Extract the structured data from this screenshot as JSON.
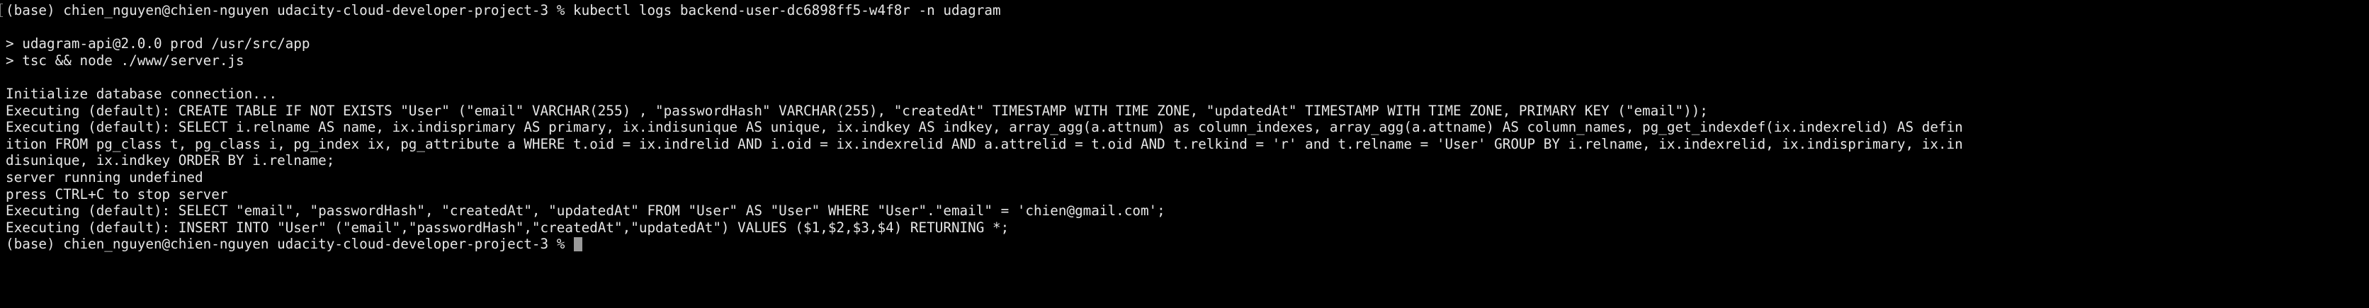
{
  "terminal": {
    "lines": [
      "(base) chien_nguyen@chien-nguyen udacity-cloud-developer-project-3 % kubectl logs backend-user-dc6898ff5-w4f8r -n udagram",
      "",
      "> udagram-api@2.0.0 prod /usr/src/app",
      "> tsc && node ./www/server.js",
      "",
      "Initialize database connection...",
      "Executing (default): CREATE TABLE IF NOT EXISTS \"User\" (\"email\" VARCHAR(255) , \"passwordHash\" VARCHAR(255), \"createdAt\" TIMESTAMP WITH TIME ZONE, \"updatedAt\" TIMESTAMP WITH TIME ZONE, PRIMARY KEY (\"email\"));",
      "Executing (default): SELECT i.relname AS name, ix.indisprimary AS primary, ix.indisunique AS unique, ix.indkey AS indkey, array_agg(a.attnum) as column_indexes, array_agg(a.attname) AS column_names, pg_get_indexdef(ix.indexrelid) AS defin",
      "ition FROM pg_class t, pg_class i, pg_index ix, pg_attribute a WHERE t.oid = ix.indrelid AND i.oid = ix.indexrelid AND a.attrelid = t.oid AND t.relkind = 'r' and t.relname = 'User' GROUP BY i.relname, ix.indexrelid, ix.indisprimary, ix.in",
      "disunique, ix.indkey ORDER BY i.relname;",
      "server running undefined",
      "press CTRL+C to stop server",
      "Executing (default): SELECT \"email\", \"passwordHash\", \"createdAt\", \"updatedAt\" FROM \"User\" AS \"User\" WHERE \"User\".\"email\" = 'chien@gmail.com';",
      "Executing (default): INSERT INTO \"User\" (\"email\",\"passwordHash\",\"createdAt\",\"updatedAt\") VALUES ($1,$2,$3,$4) RETURNING *;",
      "(base) chien_nguyen@chien-nguyen udacity-cloud-developer-project-3 % "
    ]
  },
  "colors": {
    "background": "#000000",
    "text": "#e6e6e6",
    "cursor": "#9a9a9a"
  }
}
